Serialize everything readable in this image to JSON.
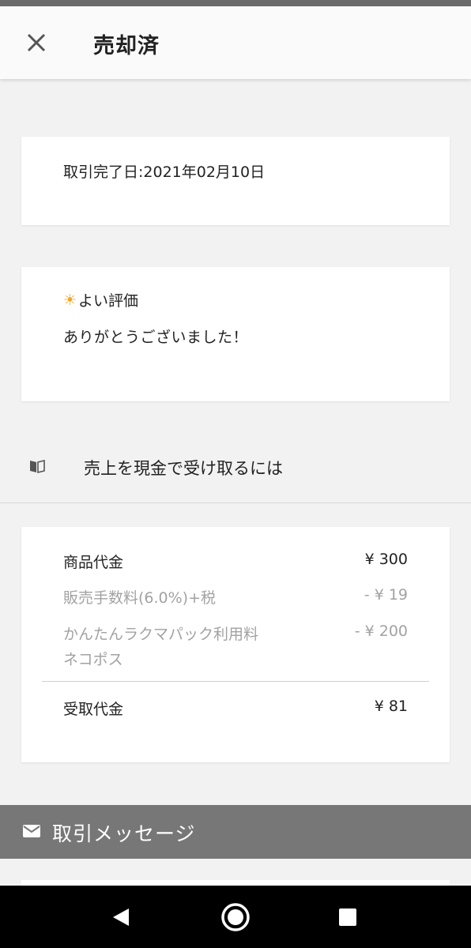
{
  "header": {
    "title": "売却済",
    "close_icon": "close-icon"
  },
  "transaction": {
    "completed_date": "取引完了日:2021年02月10日"
  },
  "review": {
    "icon": "sun-icon",
    "rating": "よい評価",
    "message": "ありがとうございました！"
  },
  "cash_link": {
    "icon": "book-icon",
    "label": "売上を現金で受け取るには"
  },
  "sales": {
    "rows": [
      {
        "label": "商品代金",
        "value": "¥ 300"
      },
      {
        "label": "販売手数料(6.0%)+税",
        "value": "- ¥ 19"
      },
      {
        "label": "かんたんラクマパック利用料",
        "value": "- ¥ 200",
        "sub": "ネコポス"
      }
    ],
    "total": {
      "label": "受取代金",
      "value": "¥ 81"
    }
  },
  "messages": {
    "icon": "mail-icon",
    "title": "取引メッセージ"
  },
  "colors": {
    "accent_sun": "#f5a623",
    "muted": "#a2a2a2",
    "section_header": "#777777"
  }
}
